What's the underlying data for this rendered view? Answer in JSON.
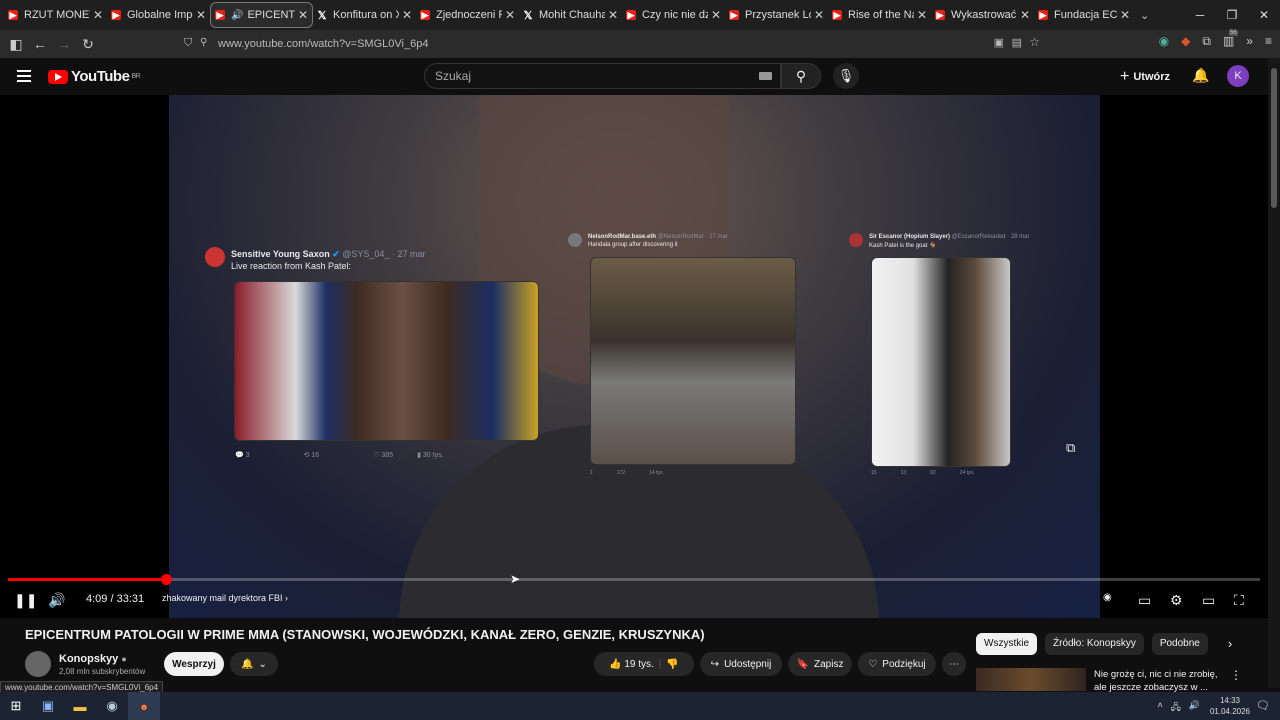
{
  "browser": {
    "tabs": [
      {
        "label": "RZUT MONETĄ DE",
        "icon": "youtube-icon",
        "active": false
      },
      {
        "label": "Globalne Imperium",
        "icon": "youtube-icon",
        "active": false
      },
      {
        "label": "EPICENTRUM",
        "icon": "youtube-icon",
        "active": true
      },
      {
        "label": "Konfitura on X",
        "icon": "x-icon",
        "active": false
      },
      {
        "label": "Zjednoczeni Przec",
        "icon": "youtube-icon",
        "active": false
      },
      {
        "label": "Mohit Chauhan on",
        "icon": "x-icon",
        "active": false
      },
      {
        "label": "Czy nic nie dzieje",
        "icon": "youtube-icon",
        "active": false
      },
      {
        "label": "Przystanek Lomba",
        "icon": "youtube-icon",
        "active": false
      },
      {
        "label": "Rise of the Nazis a",
        "icon": "youtube-icon",
        "active": false
      },
      {
        "label": "Wykastrować beze",
        "icon": "youtube-icon",
        "active": false
      },
      {
        "label": "Fundacja ECPU Po",
        "icon": "youtube-icon",
        "active": false
      }
    ],
    "url": "www.youtube.com/watch?v=SMGL0Vi_6p4",
    "extension_badge": "56"
  },
  "youtube": {
    "logo_text": "YouTube",
    "region": "BR",
    "search_placeholder": "Szukaj",
    "create_label": "Utwórz",
    "avatar_letter": "K"
  },
  "video": {
    "tweets": [
      {
        "name": "Sensitive Young Saxon",
        "handle": "@SYS_04_ · 27 mar",
        "text": "Live reaction from Kash Patel:",
        "replies": "3",
        "reposts": "16",
        "likes": "385",
        "views": "30 tys."
      },
      {
        "name": "NelsonRodMar.base.eth",
        "handle": "@NelsonRodMar · 27 mar",
        "text": "Handala group after discovering it",
        "replies": "1",
        "reposts": "",
        "likes": "172",
        "views": "14 tys."
      },
      {
        "name": "Sir Escanor (Hopium Slayer)",
        "handle": "@EscanorReloaded · 28 mar",
        "text": "Kash Patel is the goat 🐐",
        "replies": "15",
        "reposts": "13",
        "likes": "92",
        "views": "24 tys."
      }
    ],
    "progress_fraction": 0.126,
    "time_current": "4:09",
    "time_sep": " / ",
    "time_total": "33:31",
    "chapter": "zhakowany mail dyrektora FBI"
  },
  "meta": {
    "title": "EPICENTRUM PATOLOGII W PRIME MMA (STANOWSKI, WOJEWÓDZKI, KANAŁ ZERO, GENZIE, KRUSZYNKA)",
    "channel": "Konopskyy",
    "subscribers": "2,08 mln subskrybentów",
    "join_label": "Wesprzyj",
    "likes": "19 tys.",
    "share_label": "Udostępnij",
    "save_label": "Zapisz",
    "thanks_label": "Podziękuj"
  },
  "chips": [
    "Wszystkie",
    "Źródło: Konopskyy",
    "Podobne"
  ],
  "recommendation": {
    "title_line1": "Nie grożę ci, nic ci nie zrobię,",
    "title_line2": "ale jeszcze zobaczysz w ..."
  },
  "status_url": "www.youtube.com/watch?v=SMGL0Vi_6p4",
  "taskbar": {
    "time": "14:33",
    "date": "01.04.2026"
  },
  "colors": {
    "accent": "#ff0000",
    "background": "#0f0f0f",
    "avatar": "#7b3fbf"
  }
}
